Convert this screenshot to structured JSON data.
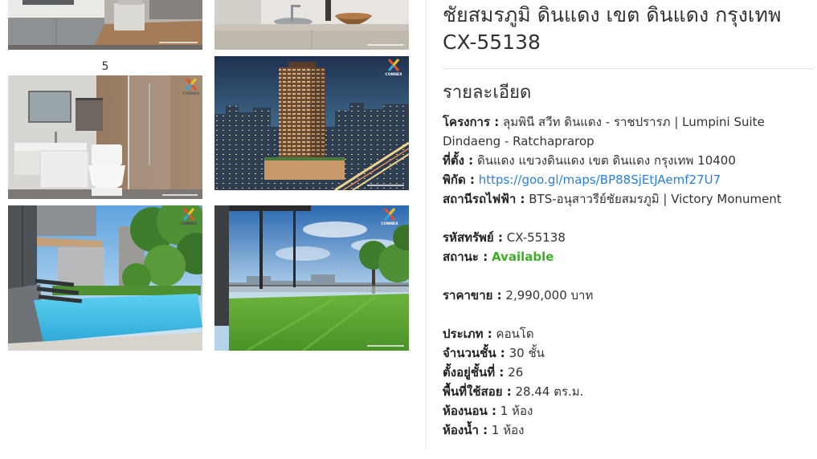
{
  "gallery": {
    "caption": "5",
    "logo_text": "CONNEX"
  },
  "listing": {
    "title": "ชัยสมรภูมิ ดินแดง เขต ดินแดง กรุงเทพ CX-55138",
    "details_heading": "รายละเอียด",
    "project": {
      "label": "โครงการ :",
      "value": "ลุมพินี สวีท ดินแดง - ราชปรารภ | Lumpini Suite Dindaeng - Ratchaprarop"
    },
    "address": {
      "label": "ที่ตั้ง :",
      "value": "ดินแดง แขวงดินแดง เขต ดินแดง กรุงเทพ 10400"
    },
    "map_link": {
      "label": "พิกัด :",
      "value": "https://goo.gl/maps/BP88SjEtJAemf27U7"
    },
    "train_station": {
      "label": "สถานีรถไฟฟ้า :",
      "value": "BTS-อนุสาวรีย์ชัยสมรภูมิ | Victory Monument"
    },
    "property_code": {
      "label": "รหัสทรัพย์ :",
      "value": "CX-55138"
    },
    "status": {
      "label": "สถานะ :",
      "value": "Available"
    },
    "sale_price": {
      "label": "ราคาขาย :",
      "value": "2,990,000 บาท"
    },
    "property_type": {
      "label": "ประเภท :",
      "value": "คอนโด"
    },
    "total_floors": {
      "label": "จำนวนชั้น :",
      "value": "30 ชั้น"
    },
    "unit_floor": {
      "label": "ตั้งอยู่ชั้นที่ :",
      "value": "26"
    },
    "usable_area": {
      "label": "พื้นที่ใช้สอย :",
      "value": "28.44 ตร.ม."
    },
    "bedrooms": {
      "label": "ห้องนอน :",
      "value": "1 ห้อง"
    },
    "bathrooms": {
      "label": "ห้องน้ำ :",
      "value": "1 ห้อง"
    }
  },
  "colors": {
    "text": "#333333",
    "link": "#2a7fd4",
    "status_available": "#3fae2a"
  }
}
